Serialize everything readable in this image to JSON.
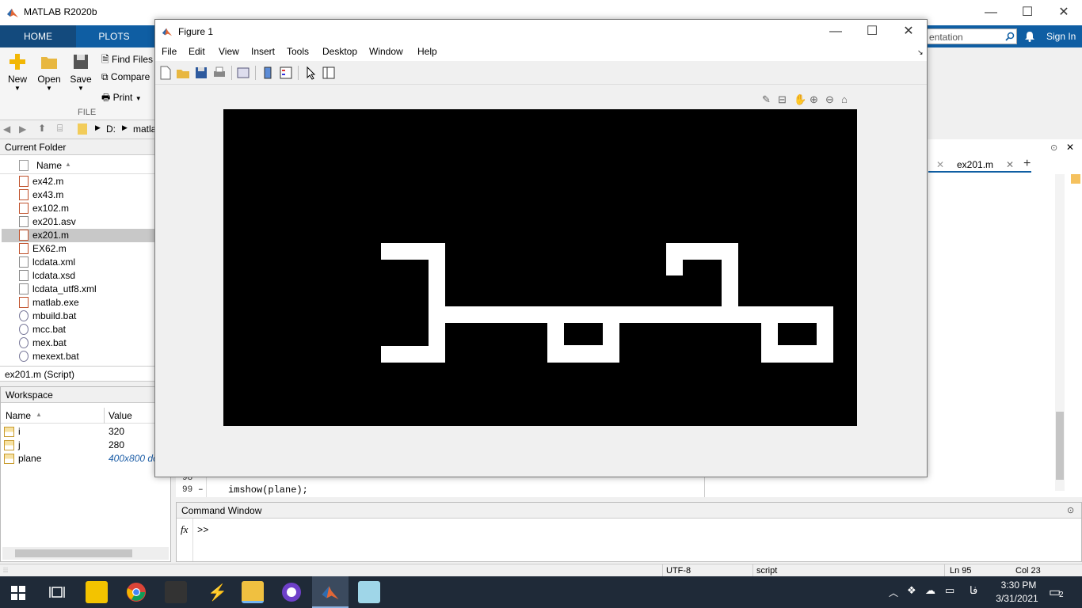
{
  "app": {
    "title": "MATLAB R2020b",
    "controls": {
      "minimize": "—",
      "maximize": "☐",
      "close": "✕"
    }
  },
  "ribbon": {
    "tabs": [
      {
        "label": "HOME"
      },
      {
        "label": "PLOTS"
      }
    ],
    "search_placeholder": "Search Documentation",
    "search_visible": "entation",
    "sign_in": "Sign In"
  },
  "toolstrip": {
    "new_label": "New",
    "open_label": "Open",
    "save_label": "Save",
    "find_files_label": "Find Files",
    "compare_label": "Compare",
    "print_label": "Print",
    "section_label": "FILE"
  },
  "address": {
    "drive": "D:",
    "folder": "matla"
  },
  "current_folder": {
    "title": "Current Folder",
    "column_name": "Name",
    "files": [
      {
        "name": "ex42.m",
        "icon": "m-file-icon"
      },
      {
        "name": "ex43.m",
        "icon": "m-file-icon"
      },
      {
        "name": "ex102.m",
        "icon": "m-file-icon"
      },
      {
        "name": "ex201.asv",
        "icon": "file-icon"
      },
      {
        "name": "ex201.m",
        "icon": "m-file-icon",
        "selected": true
      },
      {
        "name": "EX62.m",
        "icon": "m-file-icon"
      },
      {
        "name": "lcdata.xml",
        "icon": "file-icon"
      },
      {
        "name": "lcdata.xsd",
        "icon": "schema-icon"
      },
      {
        "name": "lcdata_utf8.xml",
        "icon": "file-icon"
      },
      {
        "name": "matlab.exe",
        "icon": "matlab-icon"
      },
      {
        "name": "mbuild.bat",
        "icon": "bat-icon"
      },
      {
        "name": "mcc.bat",
        "icon": "bat-icon"
      },
      {
        "name": "mex.bat",
        "icon": "bat-icon"
      },
      {
        "name": "mexext.bat",
        "icon": "bat-icon"
      }
    ],
    "details": "ex201.m  (Script)"
  },
  "workspace": {
    "title": "Workspace",
    "col_name": "Name",
    "col_value": "Value",
    "vars": [
      {
        "name": "i",
        "value": "320"
      },
      {
        "name": "j",
        "value": "280"
      },
      {
        "name": "plane",
        "value": "400x800 dou"
      }
    ]
  },
  "editor": {
    "tab": "ex201.m",
    "lines": [
      {
        "num": "98",
        "code": ""
      },
      {
        "num": "99",
        "code": "imshow(plane);"
      }
    ]
  },
  "command_window": {
    "title": "Command Window",
    "prompt": ">>",
    "fx": "fx"
  },
  "statusbar": {
    "encoding": "UTF-8",
    "type": "script",
    "ln": "Ln  95",
    "col": "Col  23"
  },
  "figure": {
    "title": "Figure 1",
    "menu": [
      "File",
      "Edit",
      "View",
      "Insert",
      "Tools",
      "Desktop",
      "Window",
      "Help"
    ],
    "image_colors": {
      "background": "#000000",
      "foreground": "#ffffff"
    }
  },
  "taskbar": {
    "time": "3:30 PM",
    "date": "3/31/2021",
    "lang": "فا",
    "notifications": "2"
  }
}
